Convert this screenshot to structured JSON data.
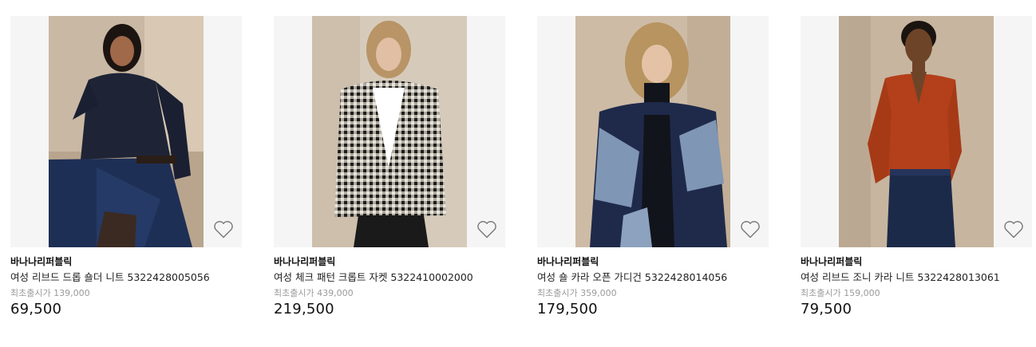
{
  "products": [
    {
      "brand": "바나나리퍼블릭",
      "name": "여성 리브드 드롭 숄더 니트 5322428005056",
      "original_price": "최초출시가 139,000",
      "price": "69,500",
      "wishlist_icon": "heart-outline-icon"
    },
    {
      "brand": "바나나리퍼블릭",
      "name": "여성 체크 패턴 크롭트 자켓 5322410002000",
      "original_price": "최초출시가 439,000",
      "price": "219,500",
      "wishlist_icon": "heart-outline-icon"
    },
    {
      "brand": "바나나리퍼블릭",
      "name": "여성 숄 카라 오픈 가디건 5322428014056",
      "original_price": "최초출시가 359,000",
      "price": "179,500",
      "wishlist_icon": "heart-outline-icon"
    },
    {
      "brand": "바나나리퍼블릭",
      "name": "여성 리브드 조니 카라 니트 5322428013061",
      "original_price": "최초출시가 159,000",
      "price": "79,500",
      "wishlist_icon": "heart-outline-icon"
    }
  ]
}
